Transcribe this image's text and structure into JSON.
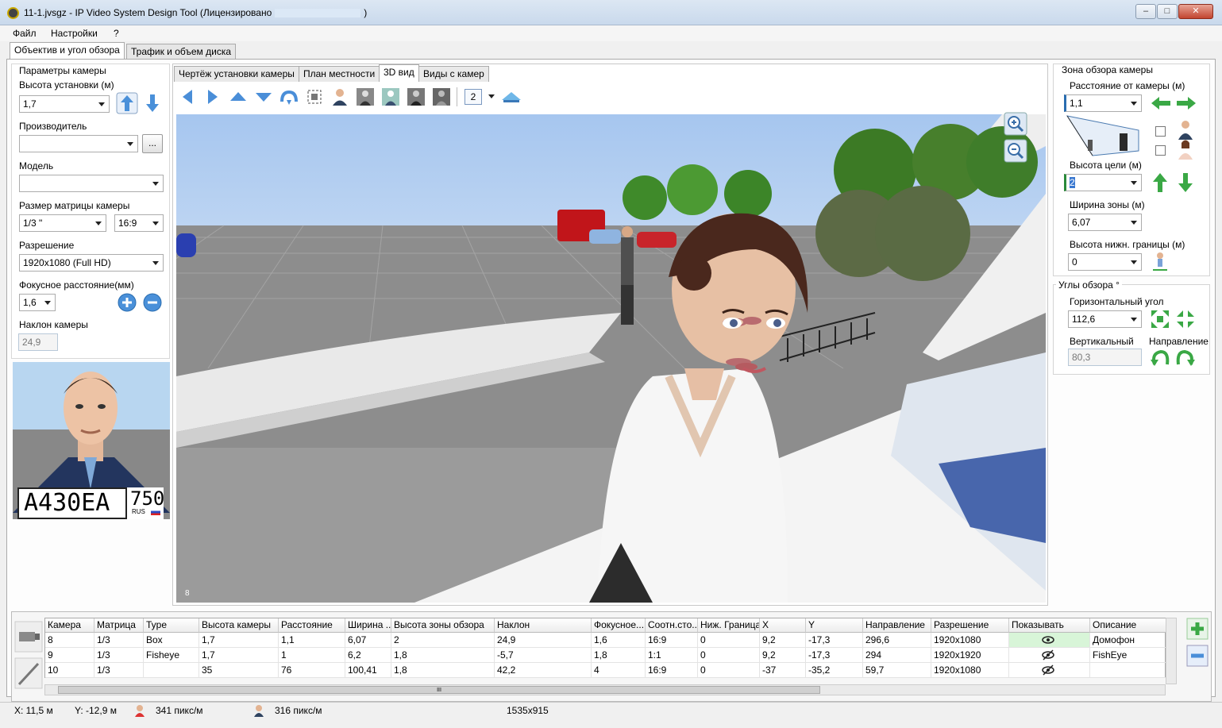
{
  "window": {
    "title_prefix": "11-1.jvsgz - IP Video System Design Tool (Лицензировано",
    "title_suffix": ")",
    "minimize": "–",
    "maximize": "□",
    "close": "✕"
  },
  "menu": {
    "file": "Файл",
    "settings": "Настройки",
    "help": "?"
  },
  "main_tabs": {
    "lens": "Объектив и угол обзора",
    "traffic": "Трафик и объем диска"
  },
  "left": {
    "group_title": "Параметры камеры",
    "height_label": "Высота установки (м)",
    "height_value": "1,7",
    "vendor_label": "Производитель",
    "vendor_value": "",
    "vendor_btn": "...",
    "model_label": "Модель",
    "model_value": "",
    "sensor_label": "Размер матрицы камеры",
    "sensor_value": "1/3 \"",
    "aspect_value": "16:9",
    "resolution_label": "Разрешение",
    "resolution_value": "1920x1080 (Full HD)",
    "focal_label": "Фокусное расстояние(мм)",
    "focal_value": "1,6",
    "tilt_label": "Наклон камеры",
    "tilt_value": "24,9",
    "plate": {
      "text": "А430ЕА",
      "region": "750",
      "country": "RUS"
    }
  },
  "view_tabs": {
    "drawing": "Чертёж установки камеры",
    "site": "План местности",
    "view3d": "3D вид",
    "cams": "Виды с камер"
  },
  "toolbar": {
    "count_value": "2"
  },
  "viewport": {
    "corner_label": "8"
  },
  "right": {
    "zone_title": "Зона обзора камеры",
    "distance_label": "Расстояние от камеры (м)",
    "distance_value": "1,1",
    "target_height_label": "Высота цели (м)",
    "target_height_value": "2",
    "zone_width_label": "Ширина зоны (м)",
    "zone_width_value": "6,07",
    "lower_bound_label": "Высота нижн. границы (м)",
    "lower_bound_value": "0",
    "angles_title": "Углы обзора °",
    "hangle_label": "Горизонтальный угол",
    "hangle_value": "112,6",
    "vangle_label": "Вертикальный",
    "vangle_value": "80,3",
    "direction_label": "Направление"
  },
  "grid": {
    "columns": [
      "Камера",
      "Матрица",
      "Type",
      "Высота камеры",
      "Расстояние",
      "Ширина ...",
      "Высота зоны обзора",
      "Наклон",
      "Фокусное...",
      "Соотн.сто...",
      "Ниж. Граница",
      "X",
      "Y",
      "Направление",
      "Разрешение",
      "Показывать",
      "Описание"
    ],
    "rows": [
      [
        "8",
        "1/3",
        "Box",
        "1,7",
        "1,1",
        "6,07",
        "2",
        "24,9",
        "1,6",
        "16:9",
        "0",
        "9,2",
        "-17,3",
        "296,6",
        "1920x1080",
        "",
        "Домофон"
      ],
      [
        "9",
        "1/3",
        "Fisheye",
        "1,7",
        "1",
        "6,2",
        "1,8",
        "-5,7",
        "1,8",
        "1:1",
        "0",
        "9,2",
        "-17,3",
        "294",
        "1920x1920",
        "",
        "FishEye"
      ],
      [
        "10",
        "1/3",
        "",
        "35",
        "76",
        "100,41",
        "1,8",
        "42,2",
        "4",
        "16:9",
        "0",
        "-37",
        "-35,2",
        "59,7",
        "1920x1080",
        "",
        ""
      ]
    ],
    "visible": [
      true,
      false,
      false
    ],
    "scroll_grip": "III"
  },
  "status": {
    "x": "X: 11,5 м",
    "y": "Y: -12,9 м",
    "density1": "341 пикс/м",
    "density2": "316 пикс/м",
    "size": "1535x915"
  }
}
